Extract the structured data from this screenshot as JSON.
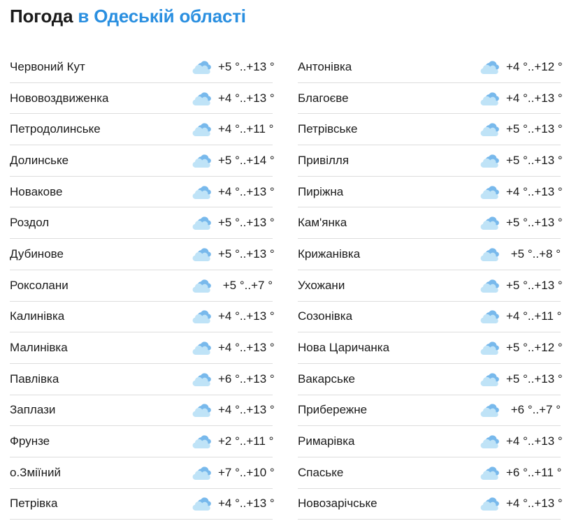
{
  "header": {
    "title_prefix": "Погода",
    "title_region": "в Одеській області"
  },
  "icon_name": "partly-cloudy-icon",
  "colors": {
    "accent": "#2a8fe0",
    "cloud_front": "#bfe3f7",
    "cloud_back": "#78b9ec",
    "divider": "#dddddd"
  },
  "left_column": [
    {
      "name": "Червоний Кут",
      "temp": "+5 °..+13 °"
    },
    {
      "name": "Нововоздвиженка",
      "temp": "+4 °..+13 °"
    },
    {
      "name": "Петродолинське",
      "temp": "+4 °..+11 °"
    },
    {
      "name": "Долинське",
      "temp": "+5 °..+14 °"
    },
    {
      "name": "Новакове",
      "temp": "+4 °..+13 °"
    },
    {
      "name": "Роздол",
      "temp": "+5 °..+13 °"
    },
    {
      "name": "Дубинове",
      "temp": "+5 °..+13 °"
    },
    {
      "name": "Роксолани",
      "temp": "+5 °..+7 °"
    },
    {
      "name": "Калинівка",
      "temp": "+4 °..+13 °"
    },
    {
      "name": "Малинівка",
      "temp": "+4 °..+13 °"
    },
    {
      "name": "Павлівка",
      "temp": "+6 °..+13 °"
    },
    {
      "name": "Заплази",
      "temp": "+4 °..+13 °"
    },
    {
      "name": "Фрунзе",
      "temp": "+2 °..+11 °"
    },
    {
      "name": "о.Зміїний",
      "temp": "+7 °..+10 °"
    },
    {
      "name": "Петрівка",
      "temp": "+4 °..+13 °"
    }
  ],
  "right_column": [
    {
      "name": "Антонівка",
      "temp": "+4 °..+12 °"
    },
    {
      "name": "Благоєве",
      "temp": "+4 °..+13 °"
    },
    {
      "name": "Петрівське",
      "temp": "+5 °..+13 °"
    },
    {
      "name": "Привілля",
      "temp": "+5 °..+13 °"
    },
    {
      "name": "Пиріжна",
      "temp": "+4 °..+13 °"
    },
    {
      "name": "Кам'янка",
      "temp": "+5 °..+13 °"
    },
    {
      "name": "Крижанівка",
      "temp": "+5 °..+8 °"
    },
    {
      "name": "Ухожани",
      "temp": "+5 °..+13 °"
    },
    {
      "name": "Созонівка",
      "temp": "+4 °..+11 °"
    },
    {
      "name": "Нова Царичанка",
      "temp": "+5 °..+12 °"
    },
    {
      "name": "Вакарське",
      "temp": "+5 °..+13 °"
    },
    {
      "name": "Прибережне",
      "temp": "+6 °..+7 °"
    },
    {
      "name": "Римарівка",
      "temp": "+4 °..+13 °"
    },
    {
      "name": "Спаське",
      "temp": "+6 °..+11 °"
    },
    {
      "name": "Новозарічське",
      "temp": "+4 °..+13 °"
    }
  ]
}
